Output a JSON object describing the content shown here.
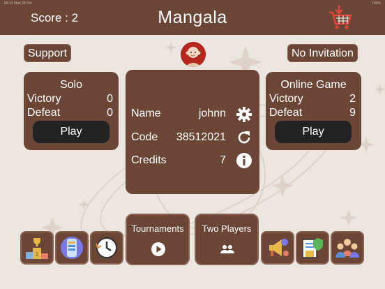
{
  "status_bar": {
    "left": "09:13  Mon 28 Oct",
    "right": "100%"
  },
  "header": {
    "score_label": "Score : 2",
    "title": "Mangala"
  },
  "buttons": {
    "support": "Support",
    "invitation": "No Invitation"
  },
  "solo": {
    "title": "Solo",
    "victory_label": "Victory",
    "victory_value": "0",
    "defeat_label": "Defeat",
    "defeat_value": "0",
    "play_label": "Play"
  },
  "online": {
    "title": "Online Game",
    "victory_label": "Victory",
    "victory_value": "2",
    "defeat_label": "Defeat",
    "defeat_value": "9",
    "play_label": "Play"
  },
  "profile": {
    "name_label": "Name",
    "name_value": "johnn",
    "code_label": "Code",
    "code_value": "38512021",
    "credits_label": "Credits",
    "credits_value": "7"
  },
  "bottom": {
    "tournaments_label": "Tournaments",
    "two_players_label": "Two Players"
  },
  "colors": {
    "panel": "#6b4637",
    "background": "#ece6e0",
    "play_button": "#222222"
  },
  "icons": [
    "cart-icon",
    "avatar-icon",
    "gear-icon",
    "refresh-icon",
    "info-icon",
    "podium-icon",
    "phone-icon",
    "history-icon",
    "play-circle-icon",
    "people-icon",
    "megaphone-icon",
    "privacy-icon",
    "team-icon"
  ]
}
